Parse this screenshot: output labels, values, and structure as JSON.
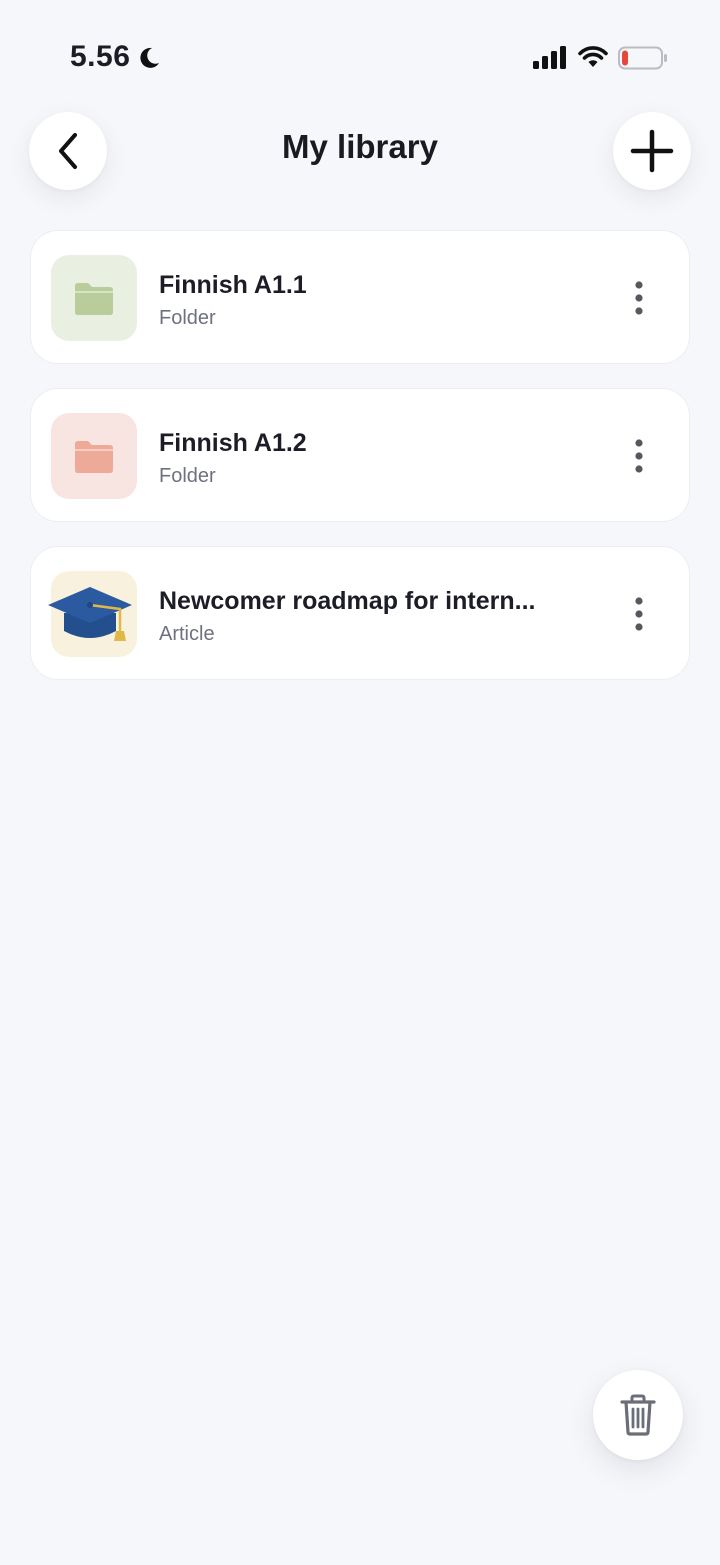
{
  "status_bar": {
    "time": "5.56",
    "icons": [
      "moon-icon",
      "cellular-signal-icon",
      "wifi-icon",
      "battery-low-icon"
    ],
    "battery_color": "#e5483b"
  },
  "header": {
    "title": "My library",
    "back_icon": "chevron-left-icon",
    "add_icon": "plus-icon"
  },
  "library_items": [
    {
      "title": "Finnish A1.1",
      "type": "Folder",
      "icon": "folder-icon",
      "thumb_bg": "#e9efe1",
      "icon_color": "#b8cc9c"
    },
    {
      "title": "Finnish A1.2",
      "type": "Folder",
      "icon": "folder-icon",
      "thumb_bg": "#f8e4e1",
      "icon_color": "#eeaa98"
    },
    {
      "title": "Newcomer roadmap for intern...",
      "type": "Article",
      "icon": "graduation-cap-icon",
      "thumb_bg": "#f8f1dd",
      "icon_color": "#2c5aa0"
    }
  ],
  "more_icon": "vertical-ellipsis-icon",
  "trash_icon": "trash-icon"
}
